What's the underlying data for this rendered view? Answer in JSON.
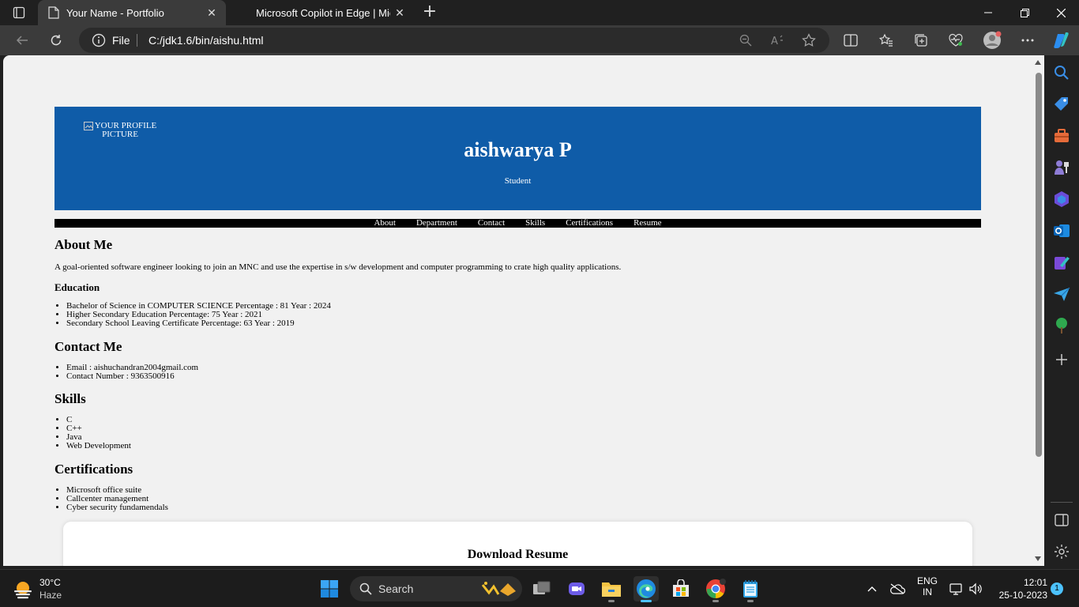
{
  "browser": {
    "tabs": [
      {
        "title": "Your Name - Portfolio",
        "close": "✕"
      },
      {
        "title": "Microsoft Copilot in Edge | Micro",
        "close": "✕"
      }
    ],
    "new_tab": "+",
    "address": {
      "scheme_label": "File",
      "url": "C:/jdk1.6/bin/aishu.html"
    }
  },
  "page": {
    "profile_alt": "YOUR PROFILE PICTURE",
    "name": "aishwarya P",
    "role": "Student",
    "nav": [
      "About",
      "Department",
      "Contact",
      "Skills",
      "Certifications",
      "Resume"
    ],
    "about": {
      "heading": "About Me",
      "text": "A goal-oriented software engineer looking to join an MNC and use the expertise in s/w development and computer programming to crate high quality applications."
    },
    "education": {
      "heading": "Education",
      "items": [
        "Bachelor of Science in COMPUTER SCIENCE Percentage : 81 Year : 2024",
        "Higher Secondary Education Percentage: 75 Year : 2021",
        "Secondary School Leaving Certificate Percentage: 63 Year : 2019"
      ]
    },
    "contact": {
      "heading": "Contact Me",
      "items": [
        "Email : aishuchandran2004gmail.com",
        "Contact Number : 9363500916"
      ]
    },
    "skills": {
      "heading": "Skills",
      "items": [
        "C",
        "C++",
        "Java",
        "Web Development"
      ]
    },
    "certifications": {
      "heading": "Certifications",
      "items": [
        "Microsoft office suite",
        "Callcenter management",
        "Cyber security fundamendals"
      ]
    },
    "resume": {
      "heading": "Download Resume"
    }
  },
  "taskbar": {
    "weather": {
      "temp": "30°C",
      "condition": "Haze"
    },
    "search_label": "Search",
    "lang": {
      "line1": "ENG",
      "line2": "IN"
    },
    "time": "12:01",
    "date": "25-10-2023",
    "notifications": "1"
  },
  "colors": {
    "hero_bg": "#0f5ca8",
    "page_bg": "#f1f1f1",
    "nav_bg": "#000000",
    "accent": "#4cc2ff"
  }
}
